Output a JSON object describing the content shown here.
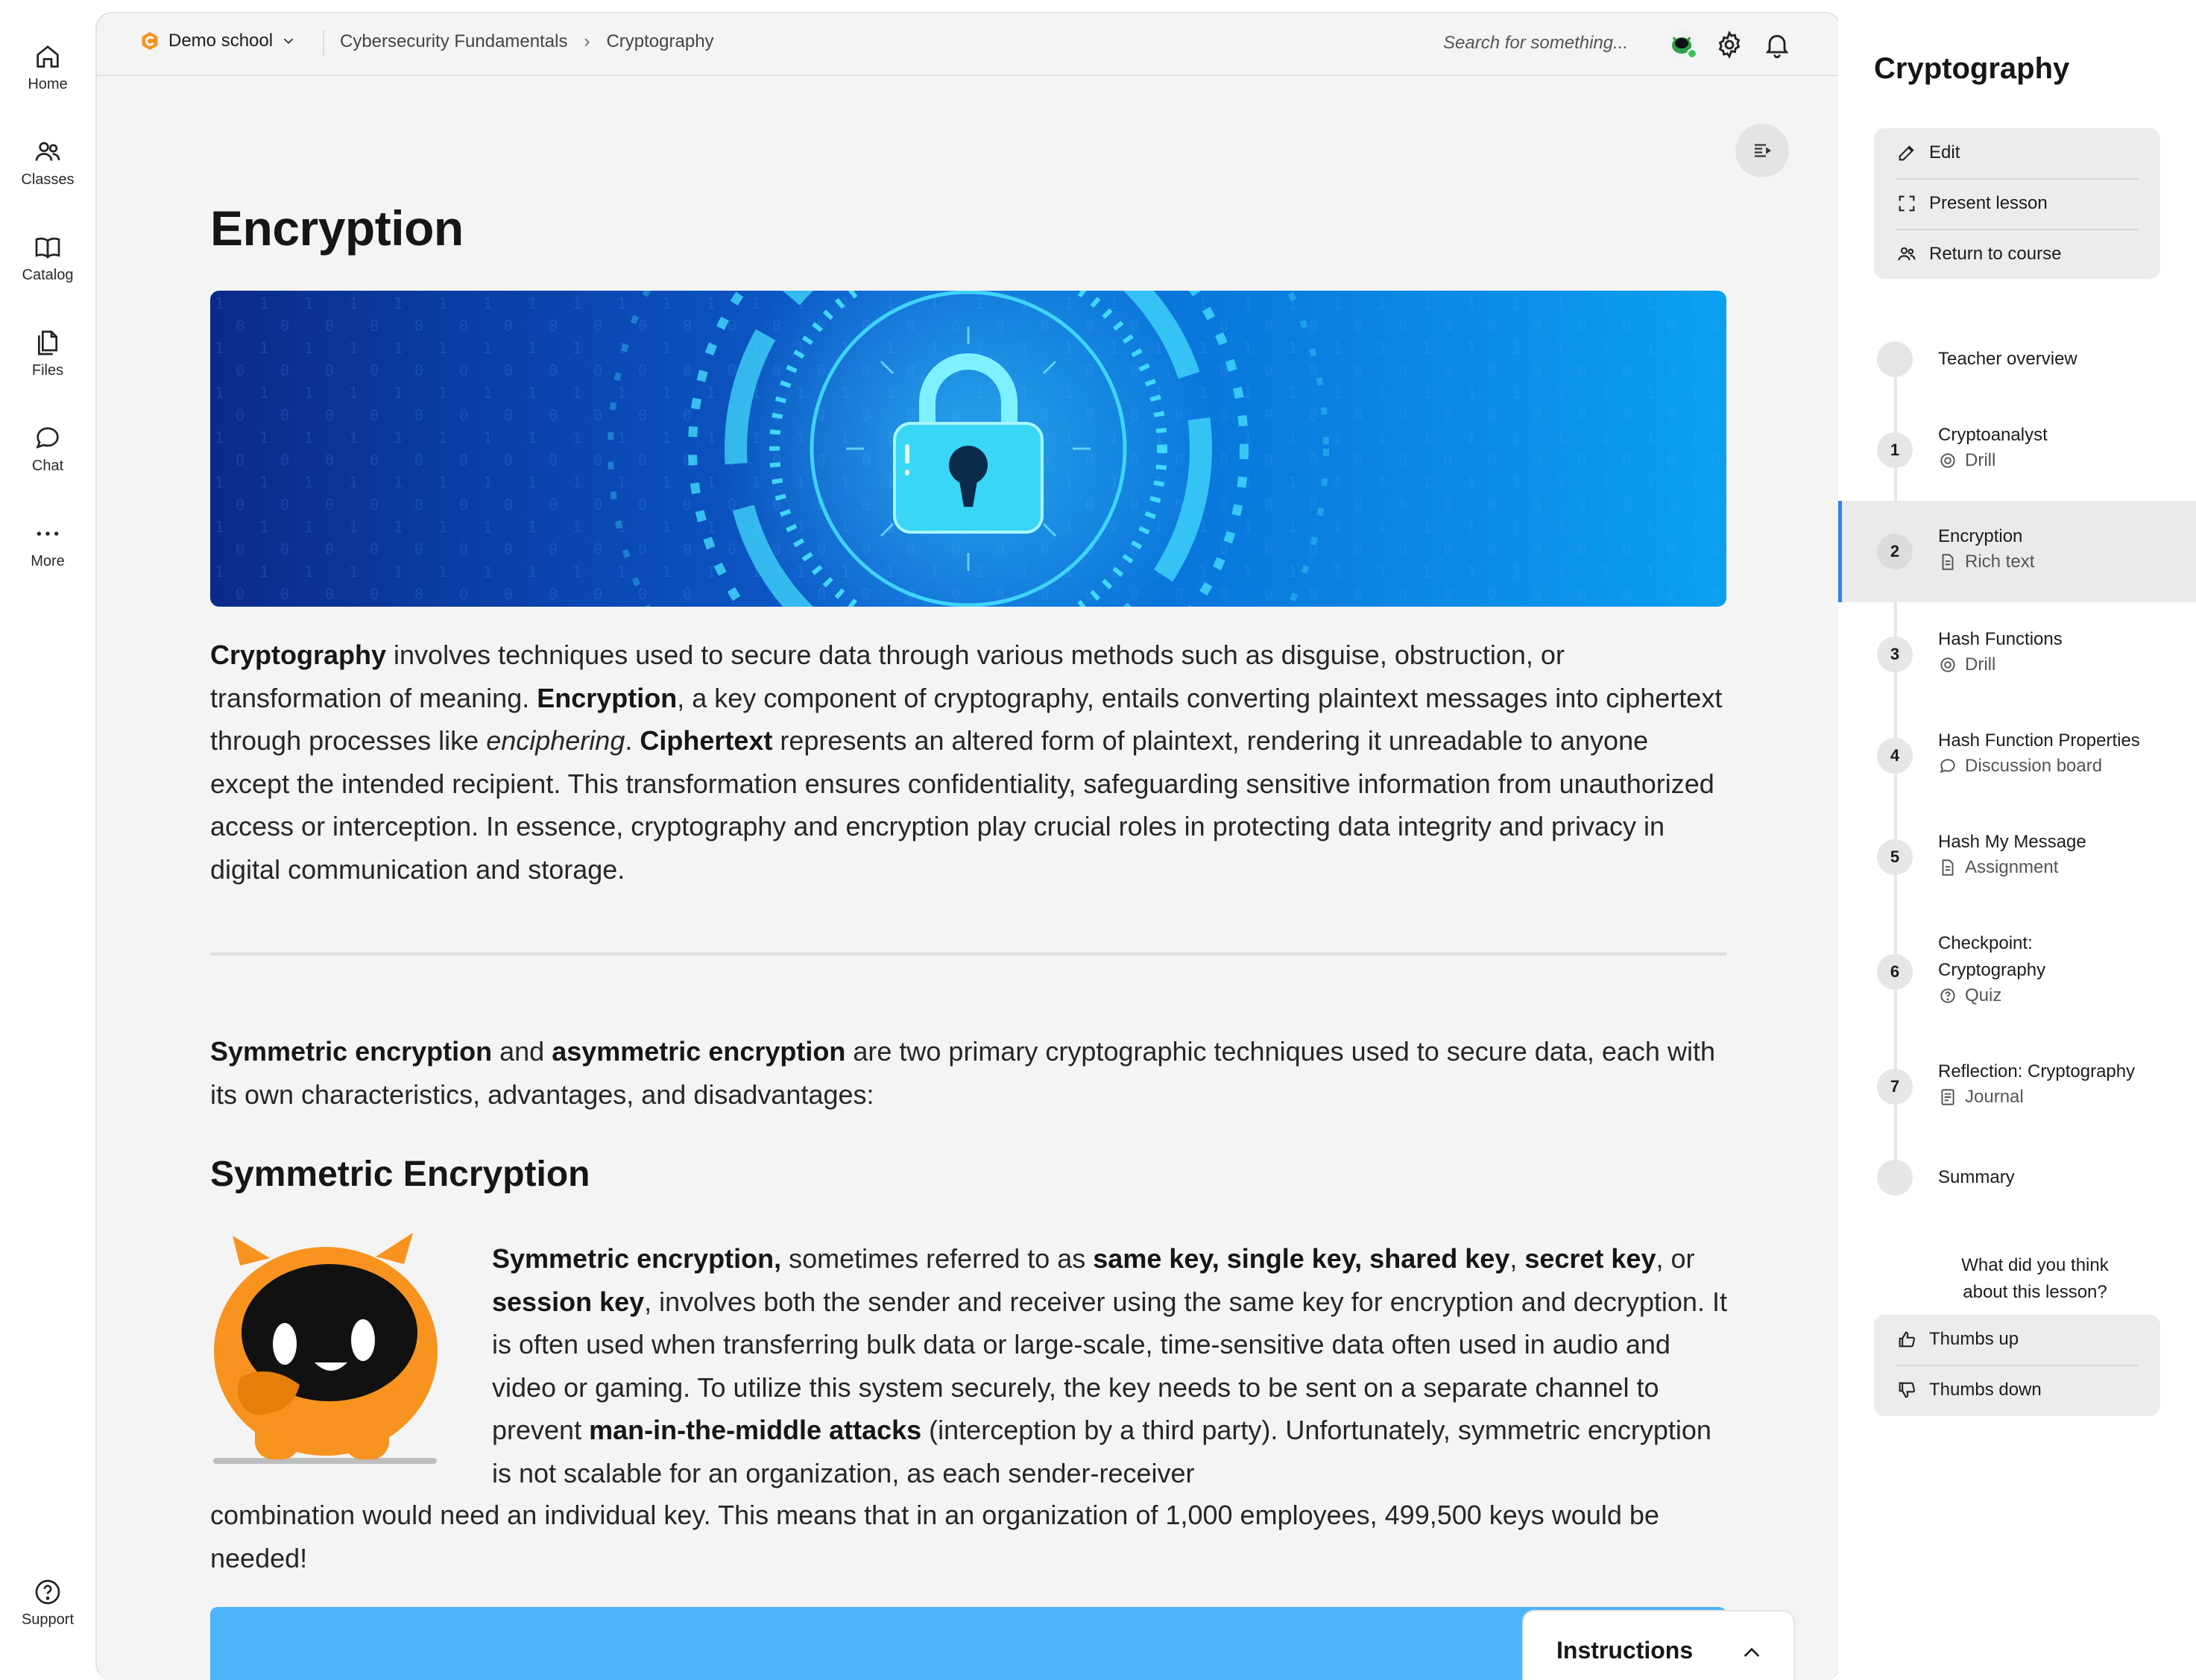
{
  "nav": {
    "items": [
      {
        "label": "Home",
        "icon": "home-icon"
      },
      {
        "label": "Classes",
        "icon": "people-icon"
      },
      {
        "label": "Catalog",
        "icon": "book-icon"
      },
      {
        "label": "Files",
        "icon": "files-icon"
      },
      {
        "label": "Chat",
        "icon": "chat-icon"
      },
      {
        "label": "More",
        "icon": "more-icon"
      }
    ],
    "support": {
      "label": "Support",
      "icon": "help-icon"
    }
  },
  "topbar": {
    "school": "Demo school",
    "breadcrumb": [
      "Cybersecurity Fundamentals",
      "Cryptography"
    ],
    "search_placeholder": "Search for something..."
  },
  "lesson": {
    "title": "Encryption",
    "intro": [
      {
        "b": "Cryptography"
      },
      {
        "t": " involves techniques used to secure data through various methods such as disguise, obstruction, or transformation of meaning. "
      },
      {
        "b": "Encryption"
      },
      {
        "t": ", a key component of cryptography, entails converting plaintext messages into ciphertext through processes like "
      },
      {
        "i": "enciphering"
      },
      {
        "t": ". "
      },
      {
        "b": "Ciphertext"
      },
      {
        "t": " represents an altered form of plaintext, rendering it unreadable to anyone except the intended recipient. This transformation ensures confidentiality, safeguarding sensitive information from unauthorized access or interception. In essence, cryptography and encryption play crucial roles in protecting data integrity and privacy in digital communication and storage."
      }
    ],
    "sym_intro": [
      {
        "b": "Symmetric encryption"
      },
      {
        "t": " and "
      },
      {
        "b": "asymmetric encryption"
      },
      {
        "t": " are two primary cryptographic techniques used to secure data, each with its own characteristics, advantages, and disadvantages:"
      }
    ],
    "sym_heading": "Symmetric Encryption",
    "sym_body": [
      {
        "b": "Symmetric encryption,"
      },
      {
        "t": " sometimes referred to as "
      },
      {
        "b": "same key, single key, shared key"
      },
      {
        "t": ", "
      },
      {
        "b": "secret key"
      },
      {
        "t": ", or "
      },
      {
        "b": "session key"
      },
      {
        "t": ", involves both the sender and receiver using the same key for encryption and decryption. It is often used when transferring bulk data or large-scale, time-sensitive data often used in audio and video or gaming. To utilize this system securely, the key needs to be sent on a separate channel to prevent "
      },
      {
        "b": "man-in-the-middle attacks"
      },
      {
        "t": " (interception by a third party). Unfortunately, symmetric encryption is not scalable for an organization, as each sender-receiver"
      }
    ],
    "sym_continued": "combination would need an individual key. This means that in an organization of 1,000 employees, 499,500 keys would be needed!",
    "instructions_label": "Instructions"
  },
  "sidebar": {
    "title": "Cryptography",
    "actions": [
      "Edit",
      "Present lesson",
      "Return to course"
    ],
    "steps": [
      {
        "num": "",
        "name": "Teacher overview",
        "type": ""
      },
      {
        "num": "1",
        "name": "Cryptoanalyst",
        "type": "Drill",
        "type_icon": "target-icon"
      },
      {
        "num": "2",
        "name": "Encryption",
        "type": "Rich text",
        "type_icon": "document-icon",
        "active": true
      },
      {
        "num": "3",
        "name": "Hash Functions",
        "type": "Drill",
        "type_icon": "target-icon"
      },
      {
        "num": "4",
        "name": "Hash Function Properties",
        "type": "Discussion board",
        "type_icon": "chat-icon"
      },
      {
        "num": "5",
        "name": "Hash My Message",
        "type": "Assignment",
        "type_icon": "document-icon"
      },
      {
        "num": "6",
        "name": "Checkpoint: Cryptography",
        "type": "Quiz",
        "type_icon": "question-icon"
      },
      {
        "num": "7",
        "name": "Reflection: Cryptography",
        "type": "Journal",
        "type_icon": "journal-icon"
      },
      {
        "num": "",
        "name": "Summary",
        "type": ""
      }
    ],
    "feedback_question": "What did you think about this lesson?",
    "feedback": [
      "Thumbs up",
      "Thumbs down"
    ]
  },
  "colors": {
    "accent": "#2d7ff9",
    "brand": "#f7931e",
    "hero": "#0a6fd6",
    "banner": "#4db5f7"
  }
}
